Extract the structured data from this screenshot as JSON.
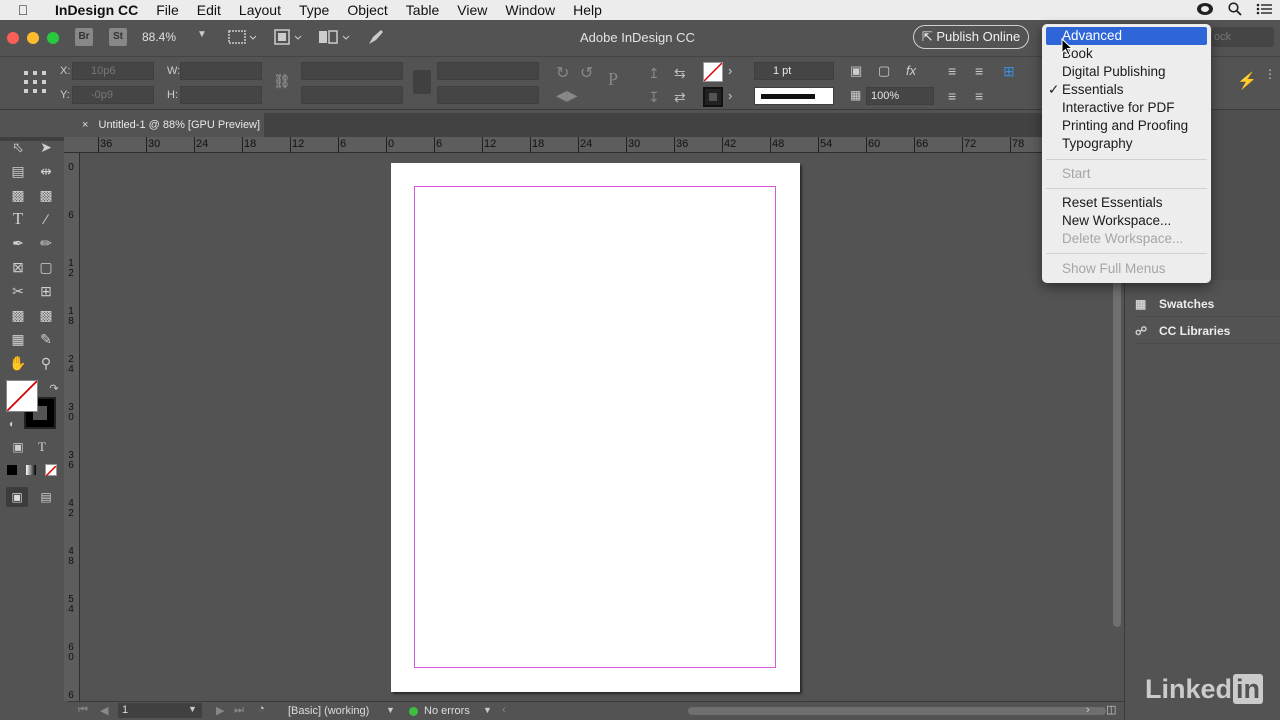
{
  "menubar": {
    "app": "InDesign CC",
    "items": [
      "File",
      "Edit",
      "Layout",
      "Type",
      "Object",
      "Table",
      "View",
      "Window",
      "Help"
    ]
  },
  "appbar": {
    "bridge": "Br",
    "stock": "St",
    "zoom": "88.4%",
    "title": "Adobe InDesign CC",
    "publish": "Publish Online",
    "search_placeholder": "ock"
  },
  "control": {
    "x_label": "X:",
    "x_value": "10p6",
    "y_label": "Y:",
    "y_value": "-0p9",
    "w_label": "W:",
    "h_label": "H:",
    "stroke_weight": "1 pt",
    "opacity": "100%"
  },
  "document": {
    "tab": "Untitled-1 @ 88% [GPU Preview]"
  },
  "ruler": {
    "h_labels": [
      "36",
      "30",
      "24",
      "18",
      "12",
      "6",
      "0",
      "6",
      "12",
      "18",
      "24",
      "30",
      "36",
      "42",
      "48",
      "54",
      "60",
      "66",
      "72",
      "78"
    ],
    "v_labels": [
      "0",
      "6",
      "12",
      "18",
      "24",
      "30",
      "36",
      "42",
      "48",
      "54",
      "60",
      "6"
    ]
  },
  "status": {
    "page": "1",
    "profile": "[Basic] (working)",
    "errors": "No errors"
  },
  "panel": {
    "items": [
      "Swatches",
      "CC Libraries"
    ]
  },
  "workspace_menu": {
    "items": [
      "Advanced",
      "Book",
      "Digital Publishing",
      "Essentials",
      "Interactive for PDF",
      "Printing and Proofing",
      "Typography"
    ],
    "checked": "Essentials",
    "start": "Start",
    "reset": "Reset Essentials",
    "new": "New Workspace...",
    "delete": "Delete Workspace...",
    "show_full": "Show Full Menus"
  },
  "watermark": {
    "text": "Linked",
    "in": "in"
  },
  "colors": {
    "accent": "#2e66d9",
    "margin_guide": "#d957d9",
    "chrome": "#535353"
  }
}
